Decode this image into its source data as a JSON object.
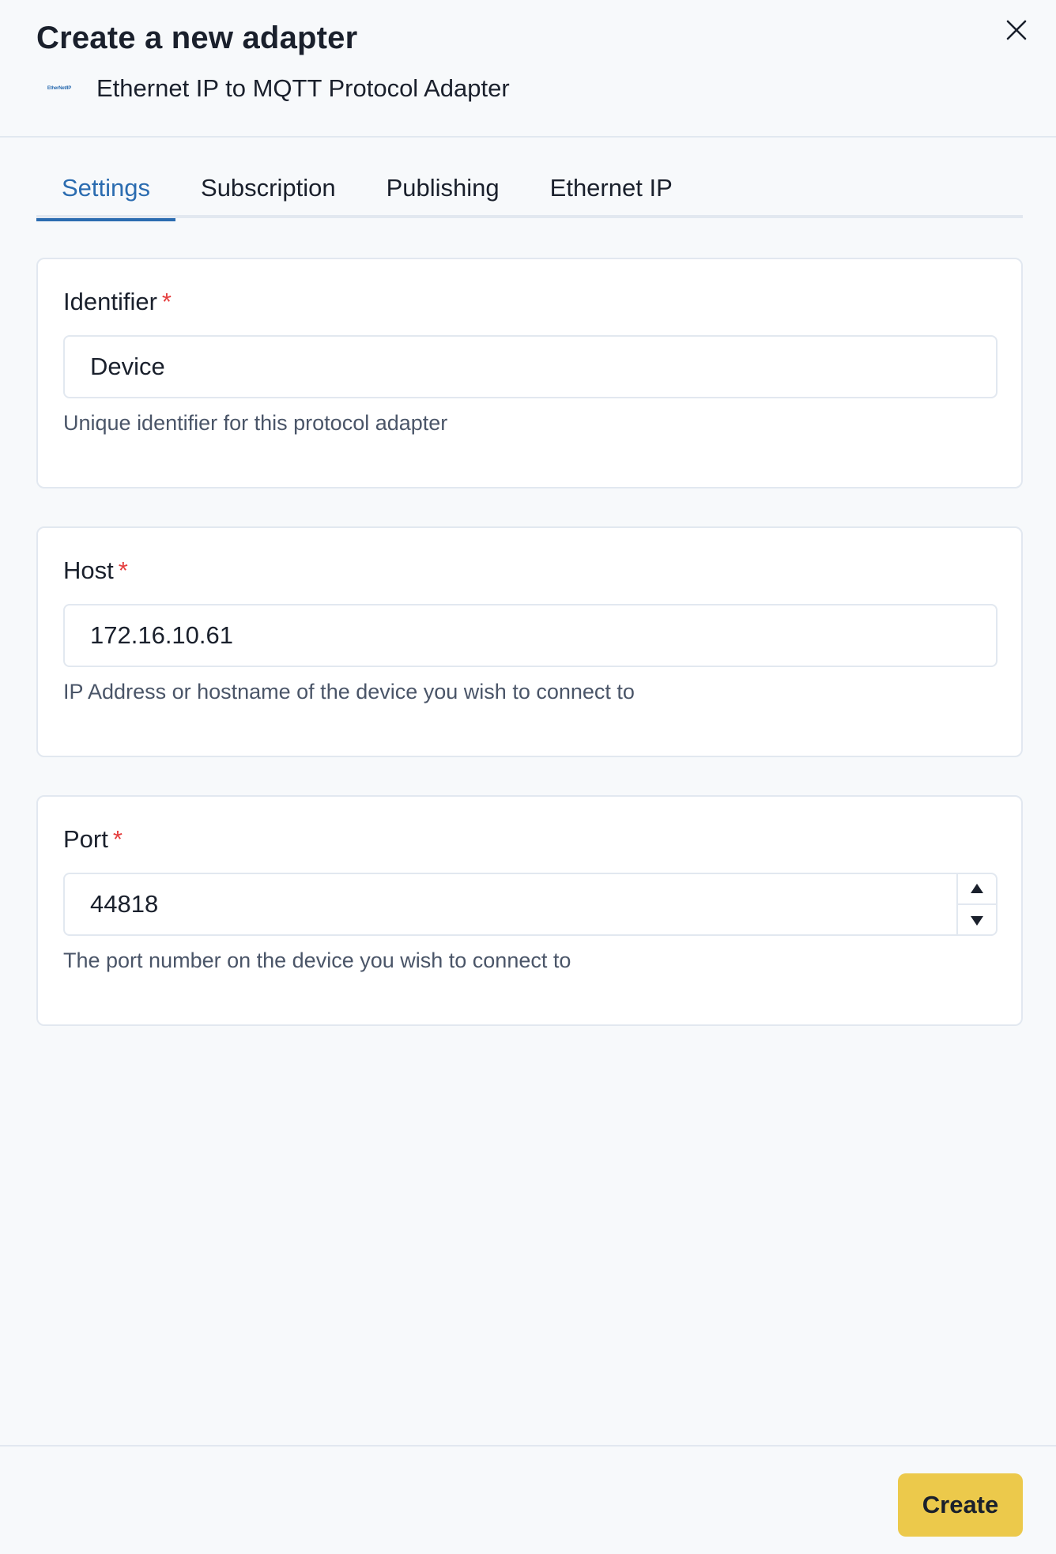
{
  "header": {
    "title": "Create a new adapter",
    "adapter_name": "Ethernet IP to MQTT Protocol Adapter",
    "logo_text": "EtherNet/IP"
  },
  "tabs": [
    {
      "label": "Settings",
      "active": true
    },
    {
      "label": "Subscription",
      "active": false
    },
    {
      "label": "Publishing",
      "active": false
    },
    {
      "label": "Ethernet IP",
      "active": false
    }
  ],
  "fields": {
    "identifier": {
      "label": "Identifier",
      "required_mark": "*",
      "value": "Device",
      "help": "Unique identifier for this protocol adapter"
    },
    "host": {
      "label": "Host",
      "required_mark": "*",
      "value": "172.16.10.61",
      "help": "IP Address or hostname of the device you wish to connect to"
    },
    "port": {
      "label": "Port",
      "required_mark": "*",
      "value": "44818",
      "help": "The port number on the device you wish to connect to"
    }
  },
  "footer": {
    "create_label": "Create"
  },
  "icons": {
    "close": "close-icon",
    "increment": "triangle-up-icon",
    "decrement": "triangle-down-icon"
  },
  "colors": {
    "accent": "#2b6cb0",
    "required": "#e53e3e",
    "primary_button": "#ecc94b"
  }
}
